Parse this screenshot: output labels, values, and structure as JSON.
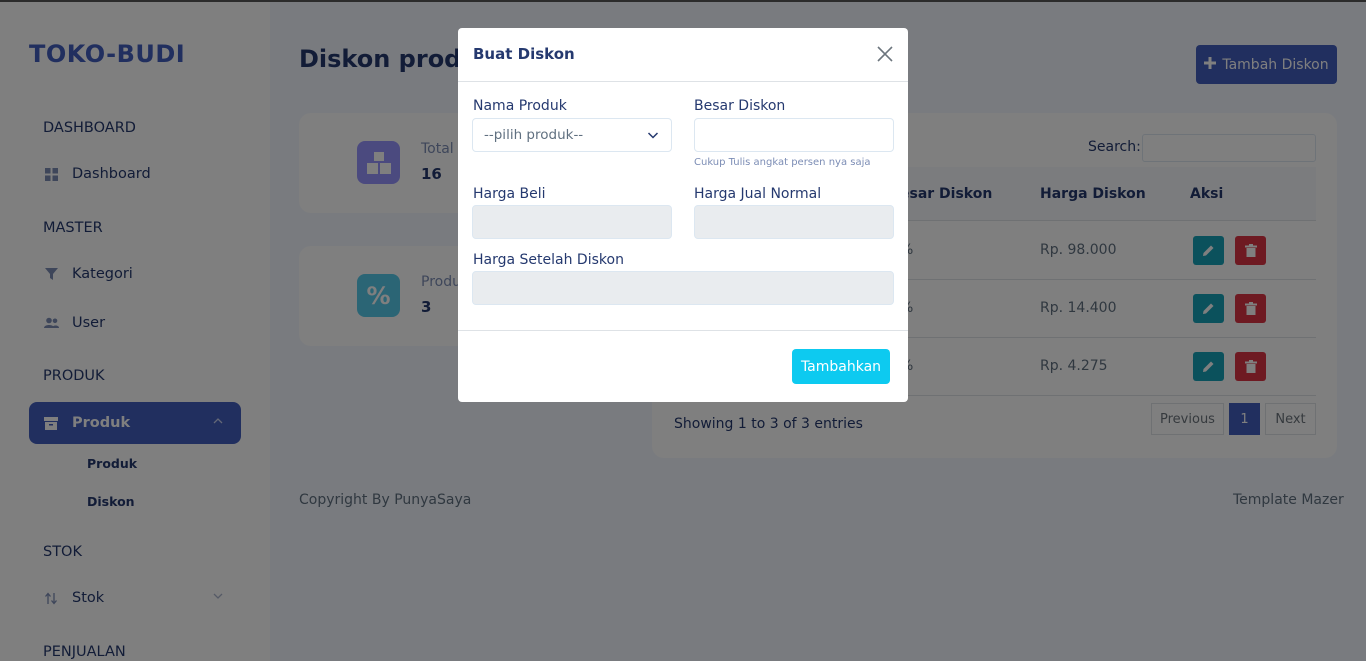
{
  "app": {
    "brand": "TOKO-BUDI"
  },
  "sidebar": {
    "sections": [
      "DASHBOARD",
      "MASTER",
      "PRODUK",
      "STOK",
      "PENJUALAN"
    ],
    "items": [
      {
        "label": "Dashboard",
        "icon": "grid-icon"
      },
      {
        "label": "Kategori",
        "icon": "filter-icon"
      },
      {
        "label": "User",
        "icon": "users-icon"
      },
      {
        "label": "Produk",
        "icon": "archive-icon"
      },
      {
        "label": "Stok",
        "icon": "sort-arrows-icon"
      }
    ],
    "subitems": [
      "Produk",
      "Diskon"
    ]
  },
  "main": {
    "title": "Diskon produk",
    "add_button": "Tambah Diskon",
    "stats": [
      {
        "label": "Total",
        "value": "16",
        "icon": "boxes-icon",
        "color": "#9694ff"
      },
      {
        "label": "Produ",
        "value": "3",
        "icon": "percent-icon",
        "color": "#57caeb"
      }
    ],
    "table": {
      "search_label": "Search:",
      "columns": [
        "esar Diskon",
        "Harga Diskon",
        "Aksi"
      ],
      "rows": [
        {
          "diskon": "%",
          "harga": "Rp. 98.000"
        },
        {
          "diskon": "%",
          "harga": "Rp. 14.400"
        },
        {
          "diskon": "%",
          "harga": "Rp. 4.275"
        }
      ],
      "showing": "Showing 1 to 3 of 3 entries",
      "pagination": {
        "previous": "Previous",
        "current": "1",
        "next": "Next"
      }
    }
  },
  "footer": {
    "left": "Copyright By PunyaSaya",
    "right": "Template Mazer"
  },
  "modal": {
    "title": "Buat Diskon",
    "fields": {
      "nama_produk": {
        "label": "Nama Produk",
        "value": "--pilih produk--"
      },
      "besar_diskon": {
        "label": "Besar Diskon",
        "value": "",
        "hint": "Cukup Tulis angkat persen nya saja"
      },
      "harga_beli": {
        "label": "Harga Beli",
        "value": ""
      },
      "harga_jual": {
        "label": "Harga Jual Normal",
        "value": ""
      },
      "harga_setelah": {
        "label": "Harga Setelah Diskon",
        "value": ""
      }
    },
    "submit": "Tambahkan"
  },
  "colors": {
    "primary": "#435ebe",
    "info": "#0dcaf0",
    "edit": "#17a2b8",
    "danger": "#dc3545"
  }
}
